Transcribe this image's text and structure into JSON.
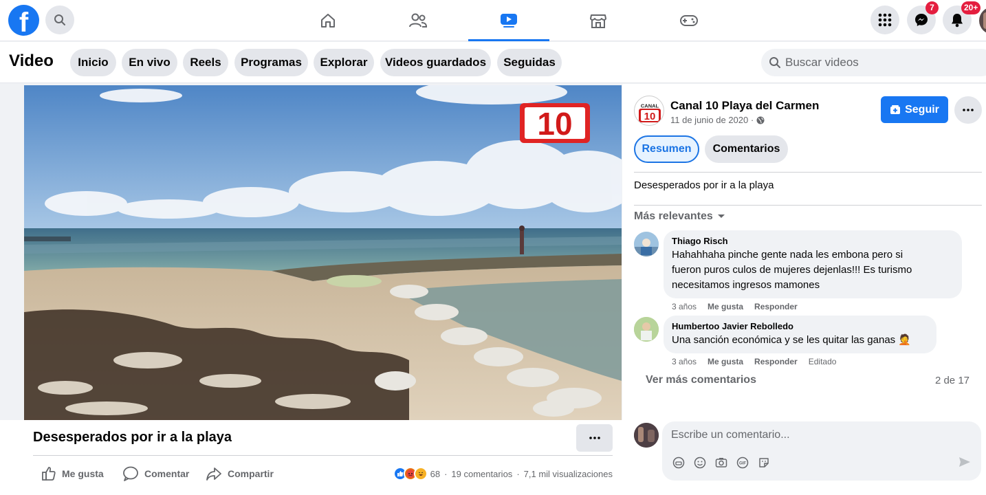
{
  "topnav": {
    "logo_letter": "f",
    "notifications": [
      {
        "name": "messenger",
        "badge": "7"
      },
      {
        "name": "notifications",
        "badge": "20+"
      }
    ]
  },
  "subnav": {
    "title": "Video",
    "tabs": [
      "Inicio",
      "En vivo",
      "Reels",
      "Programas",
      "Explorar",
      "Videos guardados",
      "Seguidas"
    ],
    "search_placeholder": "Buscar videos"
  },
  "video": {
    "overlay_logo": "10",
    "title": "Desesperados por ir a la playa",
    "actions": {
      "like": "Me gusta",
      "comment": "Comentar",
      "share": "Compartir"
    },
    "reactions_count": "68",
    "comments_count": "19 comentarios",
    "views": "7,1 mil visualizaciones"
  },
  "channel": {
    "logo_top": "CANAL",
    "logo_num": "10",
    "name": "Canal 10 Playa del Carmen",
    "date": "11 de junio de 2020 ·",
    "follow_label": "Seguir",
    "accent": "#1877f2"
  },
  "panel": {
    "tabs": [
      "Resumen",
      "Comentarios"
    ],
    "description": "Desesperados por ir a la playa",
    "sort_label": "Más relevantes"
  },
  "comments": [
    {
      "author": "Thiago Risch",
      "lines": [
        "Hahahhaha pinche gente nada les embona pero si",
        "fueron puros culos de mujeres dejenlas!!! Es turismo",
        "necesitamos ingresos mamones"
      ],
      "age": "3 años",
      "like": "Me gusta",
      "reply": "Responder"
    },
    {
      "author": "Humbertoo Javier Rebolledo",
      "lines": [
        "Una sanción económica y se les quitar las ganas 🤦"
      ],
      "age": "3 años",
      "like": "Me gusta",
      "reply": "Responder",
      "edited": "Editado"
    }
  ],
  "more_comments": "Ver más comentarios",
  "comments_position": "2 de 17",
  "composer_placeholder": "Escribe un comentario..."
}
